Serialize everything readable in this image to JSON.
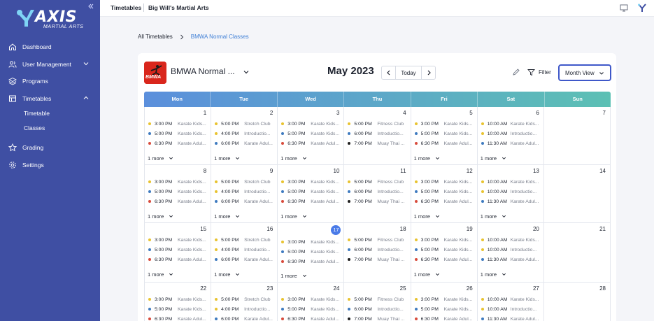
{
  "app": {
    "logo_text": "AXIS",
    "logo_sub": "MARTIAL ARTS"
  },
  "sidebar": {
    "collapse_icon": "double-chevron-left-icon",
    "items": [
      {
        "label": "Dashboard",
        "icon": "home-icon"
      },
      {
        "label": "User Management",
        "icon": "users-icon"
      },
      {
        "label": "Programs",
        "icon": "stack-icon"
      },
      {
        "label": "Timetables",
        "icon": "calendar-grid-icon"
      },
      {
        "label": "Grading",
        "icon": "star-icon"
      },
      {
        "label": "Settings",
        "icon": "gear-icon"
      }
    ],
    "sub_items": [
      {
        "label": "Timetable"
      },
      {
        "label": "Classes"
      }
    ]
  },
  "topbar": {
    "section": "Timetables",
    "org": "Big Will's Martial Arts",
    "icons": [
      "monitor-icon",
      "axis-logo-icon"
    ]
  },
  "breadcrumb": {
    "root": "All Timetables",
    "current": "BMWA Normal Classes"
  },
  "toolbar": {
    "program_logo_text": "BMWA",
    "program_name": "BMWA Normal ...",
    "month": "May 2023",
    "today_label": "Today",
    "filter_label": "Filter",
    "view_label": "Month View"
  },
  "colors": {
    "sidebar": "#3f4fa3",
    "accent": "#3f58c9",
    "header_gradient_start": "#5b8fdc",
    "header_gradient_end": "#5cc0b4",
    "today": "#4a7be8",
    "event_yellow": "#e8c330",
    "event_blue": "#3f7bc0",
    "event_red": "#d84b3c",
    "event_black": "#1f1f1f"
  },
  "calendar": {
    "weekdays": [
      "Mon",
      "Tue",
      "Wed",
      "Thu",
      "Fri",
      "Sat",
      "Sun"
    ],
    "more_label": "1 more",
    "today": "17",
    "weeks": [
      [
        {
          "day": "1",
          "events": [
            {
              "time": "3:00 PM",
              "title": "Karate Kids...",
              "color": "yellow"
            },
            {
              "time": "5:00 PM",
              "title": "Karate Kids...",
              "color": "blue"
            },
            {
              "time": "6:30 PM",
              "title": "Karate Adul...",
              "color": "red"
            }
          ],
          "more": true
        },
        {
          "day": "2",
          "events": [
            {
              "time": "5:00 PM",
              "title": "Stretch Club",
              "color": "yellow"
            },
            {
              "time": "4:00 PM",
              "title": "Introductio...",
              "color": "yellow"
            },
            {
              "time": "6:00 PM",
              "title": "Karate Adul...",
              "color": "blue"
            }
          ],
          "more": true
        },
        {
          "day": "3",
          "events": [
            {
              "time": "3:00 PM",
              "title": "Karate Kids...",
              "color": "yellow"
            },
            {
              "time": "5:00 PM",
              "title": "Karate Kids...",
              "color": "blue"
            },
            {
              "time": "6:30 PM",
              "title": "Karate Adul...",
              "color": "red"
            }
          ],
          "more": true
        },
        {
          "day": "4",
          "events": [
            {
              "time": "5:00 PM",
              "title": "Fitness Club",
              "color": "yellow"
            },
            {
              "time": "6:00 PM",
              "title": "Introductio...",
              "color": "blue"
            },
            {
              "time": "7:00 PM",
              "title": "Muay Thai ...",
              "color": "black"
            }
          ],
          "more": false
        },
        {
          "day": "5",
          "events": [
            {
              "time": "3:00 PM",
              "title": "Karate Kids...",
              "color": "yellow"
            },
            {
              "time": "5:00 PM",
              "title": "Karate Kids...",
              "color": "blue"
            },
            {
              "time": "6:30 PM",
              "title": "Karate Adul...",
              "color": "red"
            }
          ],
          "more": true
        },
        {
          "day": "6",
          "events": [
            {
              "time": "10:00 AM",
              "title": "Karate Kids...",
              "color": "yellow"
            },
            {
              "time": "10:00 AM",
              "title": "Introductio...",
              "color": "yellow"
            },
            {
              "time": "11:30 AM",
              "title": "Karate Adul...",
              "color": "blue"
            }
          ],
          "more": true
        },
        {
          "day": "7",
          "events": [],
          "more": false
        }
      ],
      [
        {
          "day": "8",
          "events": [
            {
              "time": "3:00 PM",
              "title": "Karate Kids...",
              "color": "yellow"
            },
            {
              "time": "5:00 PM",
              "title": "Karate Kids...",
              "color": "blue"
            },
            {
              "time": "6:30 PM",
              "title": "Karate Adul...",
              "color": "red"
            }
          ],
          "more": true
        },
        {
          "day": "9",
          "events": [
            {
              "time": "5:00 PM",
              "title": "Stretch Club",
              "color": "yellow"
            },
            {
              "time": "4:00 PM",
              "title": "Introductio...",
              "color": "yellow"
            },
            {
              "time": "6:00 PM",
              "title": "Karate Adul...",
              "color": "blue"
            }
          ],
          "more": true
        },
        {
          "day": "10",
          "events": [
            {
              "time": "3:00 PM",
              "title": "Karate Kids...",
              "color": "yellow"
            },
            {
              "time": "5:00 PM",
              "title": "Karate Kids...",
              "color": "blue"
            },
            {
              "time": "6:30 PM",
              "title": "Karate Adul...",
              "color": "red"
            }
          ],
          "more": true
        },
        {
          "day": "11",
          "events": [
            {
              "time": "5:00 PM",
              "title": "Fitness Club",
              "color": "yellow"
            },
            {
              "time": "6:00 PM",
              "title": "Introductio...",
              "color": "blue"
            },
            {
              "time": "7:00 PM",
              "title": "Muay Thai ...",
              "color": "black"
            }
          ],
          "more": false
        },
        {
          "day": "12",
          "events": [
            {
              "time": "3:00 PM",
              "title": "Karate Kids...",
              "color": "yellow"
            },
            {
              "time": "5:00 PM",
              "title": "Karate Kids...",
              "color": "blue"
            },
            {
              "time": "6:30 PM",
              "title": "Karate Adul...",
              "color": "red"
            }
          ],
          "more": true
        },
        {
          "day": "13",
          "events": [
            {
              "time": "10:00 AM",
              "title": "Karate Kids...",
              "color": "yellow"
            },
            {
              "time": "10:00 AM",
              "title": "Introductio...",
              "color": "yellow"
            },
            {
              "time": "11:30 AM",
              "title": "Karate Adul...",
              "color": "blue"
            }
          ],
          "more": true
        },
        {
          "day": "14",
          "events": [],
          "more": false
        }
      ],
      [
        {
          "day": "15",
          "events": [
            {
              "time": "3:00 PM",
              "title": "Karate Kids...",
              "color": "yellow"
            },
            {
              "time": "5:00 PM",
              "title": "Karate Kids...",
              "color": "blue"
            },
            {
              "time": "6:30 PM",
              "title": "Karate Adul...",
              "color": "red"
            }
          ],
          "more": true
        },
        {
          "day": "16",
          "events": [
            {
              "time": "5:00 PM",
              "title": "Stretch Club",
              "color": "yellow"
            },
            {
              "time": "4:00 PM",
              "title": "Introductio...",
              "color": "yellow"
            },
            {
              "time": "6:00 PM",
              "title": "Karate Adul...",
              "color": "blue"
            }
          ],
          "more": true
        },
        {
          "day": "17",
          "events": [
            {
              "time": "3:00 PM",
              "title": "Karate Kids...",
              "color": "yellow"
            },
            {
              "time": "5:00 PM",
              "title": "Karate Kids...",
              "color": "blue"
            },
            {
              "time": "6:30 PM",
              "title": "Karate Adul...",
              "color": "red"
            }
          ],
          "more": true
        },
        {
          "day": "18",
          "events": [
            {
              "time": "5:00 PM",
              "title": "Fitness Club",
              "color": "yellow"
            },
            {
              "time": "6:00 PM",
              "title": "Introductio...",
              "color": "blue"
            },
            {
              "time": "7:00 PM",
              "title": "Muay Thai ...",
              "color": "black"
            }
          ],
          "more": false
        },
        {
          "day": "19",
          "events": [
            {
              "time": "3:00 PM",
              "title": "Karate Kids...",
              "color": "yellow"
            },
            {
              "time": "5:00 PM",
              "title": "Karate Kids...",
              "color": "blue"
            },
            {
              "time": "6:30 PM",
              "title": "Karate Adul...",
              "color": "red"
            }
          ],
          "more": true
        },
        {
          "day": "20",
          "events": [
            {
              "time": "10:00 AM",
              "title": "Karate Kids...",
              "color": "yellow"
            },
            {
              "time": "10:00 AM",
              "title": "Introductio...",
              "color": "yellow"
            },
            {
              "time": "11:30 AM",
              "title": "Karate Adul...",
              "color": "blue"
            }
          ],
          "more": true
        },
        {
          "day": "21",
          "events": [],
          "more": false
        }
      ],
      [
        {
          "day": "22",
          "events": [
            {
              "time": "3:00 PM",
              "title": "Karate Kids...",
              "color": "yellow"
            },
            {
              "time": "5:00 PM",
              "title": "Karate Kids...",
              "color": "blue"
            },
            {
              "time": "6:30 PM",
              "title": "Karate Adul...",
              "color": "red"
            }
          ],
          "more": false
        },
        {
          "day": "23",
          "events": [
            {
              "time": "5:00 PM",
              "title": "Stretch Club",
              "color": "yellow"
            },
            {
              "time": "4:00 PM",
              "title": "Introductio...",
              "color": "yellow"
            },
            {
              "time": "6:00 PM",
              "title": "Karate Adul...",
              "color": "blue"
            }
          ],
          "more": false
        },
        {
          "day": "24",
          "events": [
            {
              "time": "3:00 PM",
              "title": "Karate Kids...",
              "color": "yellow"
            },
            {
              "time": "5:00 PM",
              "title": "Karate Kids...",
              "color": "blue"
            },
            {
              "time": "6:30 PM",
              "title": "Karate Adul...",
              "color": "red"
            }
          ],
          "more": false
        },
        {
          "day": "25",
          "events": [
            {
              "time": "5:00 PM",
              "title": "Fitness Club",
              "color": "yellow"
            },
            {
              "time": "6:00 PM",
              "title": "Introductio...",
              "color": "blue"
            },
            {
              "time": "7:00 PM",
              "title": "Muay Thai ...",
              "color": "black"
            }
          ],
          "more": false
        },
        {
          "day": "26",
          "events": [
            {
              "time": "3:00 PM",
              "title": "Karate Kids...",
              "color": "yellow"
            },
            {
              "time": "5:00 PM",
              "title": "Karate Kids...",
              "color": "blue"
            },
            {
              "time": "6:30 PM",
              "title": "Karate Adul...",
              "color": "red"
            }
          ],
          "more": false
        },
        {
          "day": "27",
          "events": [
            {
              "time": "10:00 AM",
              "title": "Karate Kids...",
              "color": "yellow"
            },
            {
              "time": "10:00 AM",
              "title": "Introductio...",
              "color": "yellow"
            },
            {
              "time": "11:30 AM",
              "title": "Karate Adul...",
              "color": "blue"
            }
          ],
          "more": false
        },
        {
          "day": "28",
          "events": [],
          "more": false
        }
      ]
    ]
  }
}
